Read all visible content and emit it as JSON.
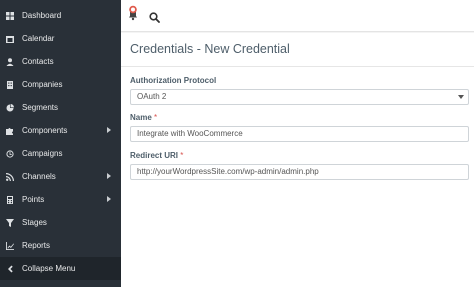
{
  "sidebar": {
    "items": [
      {
        "label": "Dashboard",
        "icon": "dashboard-icon",
        "submenu": false
      },
      {
        "label": "Calendar",
        "icon": "calendar-icon",
        "submenu": false
      },
      {
        "label": "Contacts",
        "icon": "user-icon",
        "submenu": false
      },
      {
        "label": "Companies",
        "icon": "building-icon",
        "submenu": false
      },
      {
        "label": "Segments",
        "icon": "pie-chart-icon",
        "submenu": false
      },
      {
        "label": "Components",
        "icon": "puzzle-icon",
        "submenu": true
      },
      {
        "label": "Campaigns",
        "icon": "clock-icon",
        "submenu": false
      },
      {
        "label": "Channels",
        "icon": "rss-icon",
        "submenu": true
      },
      {
        "label": "Points",
        "icon": "calculator-icon",
        "submenu": true
      },
      {
        "label": "Stages",
        "icon": "filter-icon",
        "submenu": false
      },
      {
        "label": "Reports",
        "icon": "line-chart-icon",
        "submenu": false
      }
    ],
    "collapse_label": "Collapse Menu"
  },
  "header": {
    "notification_icon": "bell-icon",
    "search_icon": "search-icon"
  },
  "page": {
    "title": "Credentials - New Credential"
  },
  "form": {
    "protocol_label": "Authorization Protocol",
    "protocol_value": "OAuth 2",
    "name_label": "Name",
    "name_value": "Integrate with WooCommerce",
    "redirect_label": "Redirect URI",
    "redirect_value": "http://yourWordpressSite.com/wp-admin/admin.php",
    "required_mark": "*"
  },
  "colors": {
    "sidebar_bg": "#293038",
    "required": "#d9534f",
    "badge": "#e05a4b"
  }
}
